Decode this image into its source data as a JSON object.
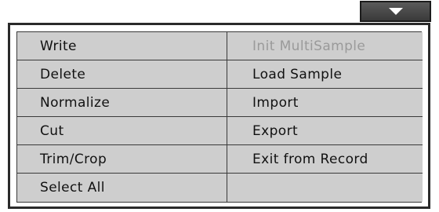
{
  "dropdown": {
    "icon": "triangle-down-icon"
  },
  "menu": {
    "left": [
      {
        "label": "Write",
        "enabled": true
      },
      {
        "label": "Delete",
        "enabled": true
      },
      {
        "label": "Normalize",
        "enabled": true
      },
      {
        "label": "Cut",
        "enabled": true
      },
      {
        "label": "Trim/Crop",
        "enabled": true
      },
      {
        "label": "Select All",
        "enabled": true
      }
    ],
    "right": [
      {
        "label": "Init MultiSample",
        "enabled": false
      },
      {
        "label": "Load Sample",
        "enabled": true
      },
      {
        "label": "Import",
        "enabled": true
      },
      {
        "label": "Export",
        "enabled": true
      },
      {
        "label": "Exit from Record",
        "enabled": true
      },
      {
        "label": "",
        "enabled": false
      }
    ]
  },
  "colors": {
    "item_bg": "#cecece",
    "disabled_text": "#9a9a9a",
    "toggle_bg": "#4a4a4a"
  }
}
